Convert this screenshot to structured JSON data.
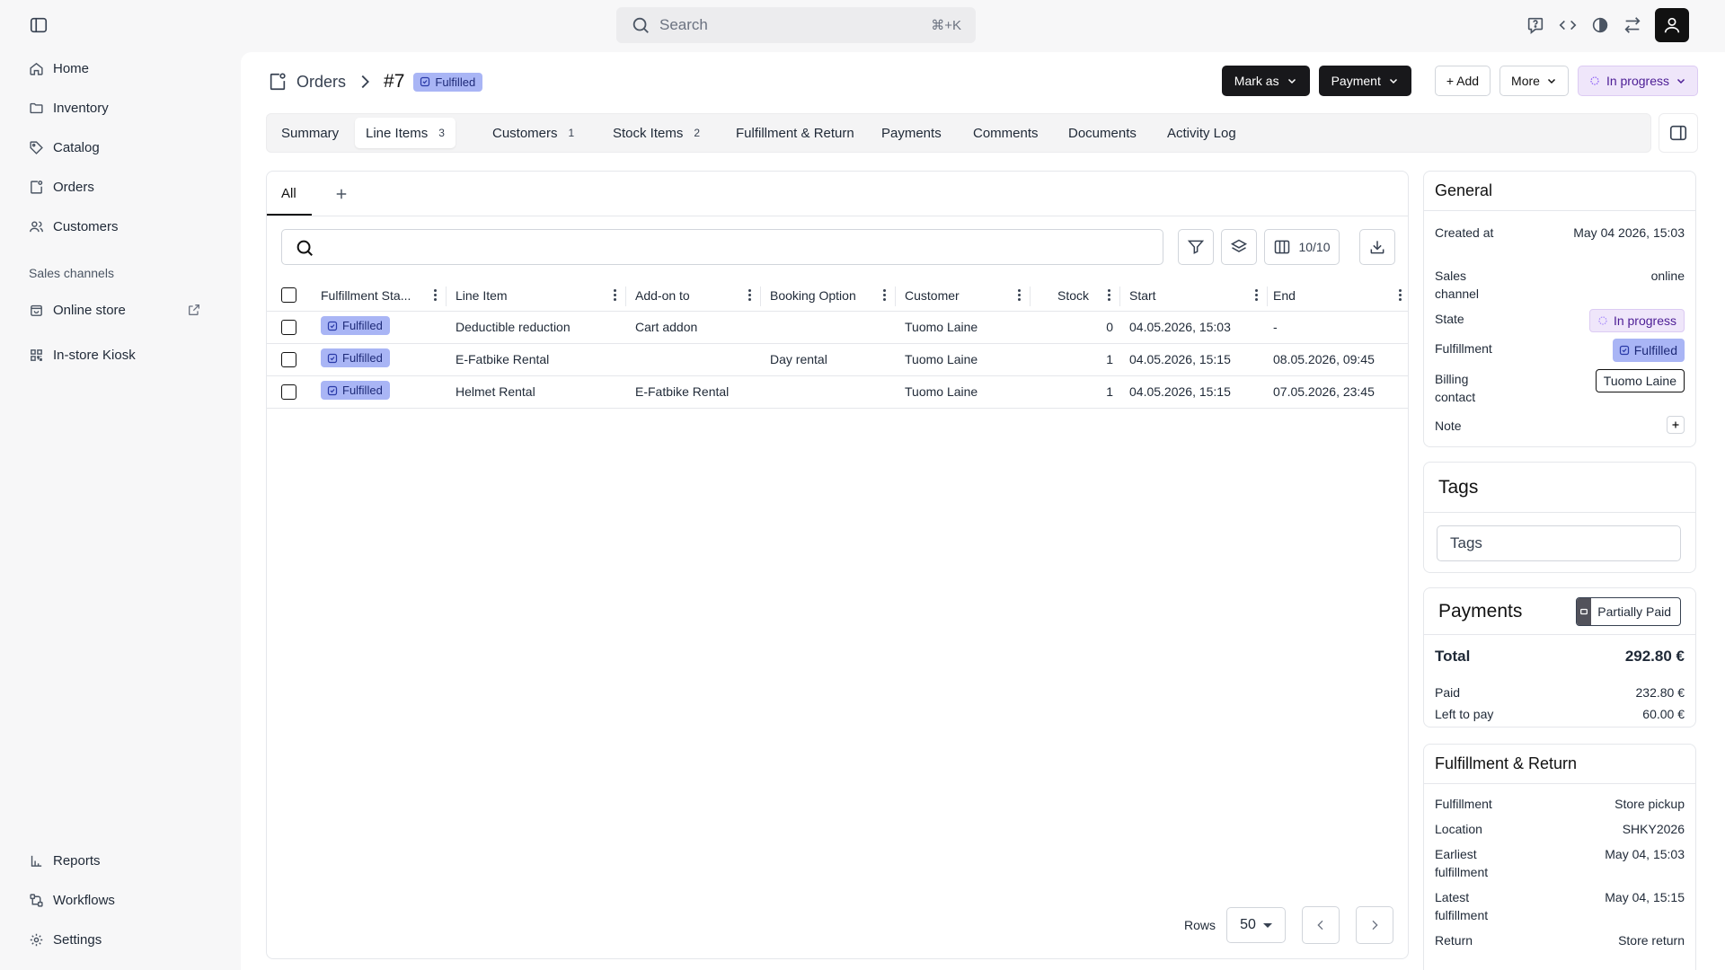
{
  "search": {
    "placeholder": "Search",
    "shortcut": "⌘+K"
  },
  "sidebar": {
    "items": [
      {
        "label": "Home",
        "icon": "home-icon"
      },
      {
        "label": "Inventory",
        "icon": "folder-icon"
      },
      {
        "label": "Catalog",
        "icon": "tag-icon"
      },
      {
        "label": "Orders",
        "icon": "orders-icon"
      },
      {
        "label": "Customers",
        "icon": "users-icon"
      }
    ],
    "section_title": "Sales channels",
    "channels": [
      {
        "label": "Online store"
      },
      {
        "label": "In-store Kiosk"
      }
    ],
    "bottom_items": [
      {
        "label": "Reports"
      },
      {
        "label": "Workflows"
      },
      {
        "label": "Settings"
      }
    ]
  },
  "header": {
    "breadcrumb": "Orders",
    "order_id": "#7",
    "status_badge": "Fulfilled",
    "actions": {
      "mark_as": "Mark as",
      "payment": "Payment",
      "add": "+ Add",
      "more": "More",
      "state": "In progress"
    }
  },
  "tabs": [
    {
      "label": "Summary",
      "count": ""
    },
    {
      "label": "Line Items",
      "count": "3"
    },
    {
      "label": "Customers",
      "count": "1"
    },
    {
      "label": "Stock Items",
      "count": "2"
    },
    {
      "label": "Fulfillment & Return",
      "count": ""
    },
    {
      "label": "Payments",
      "count": ""
    },
    {
      "label": "Comments",
      "count": ""
    },
    {
      "label": "Documents",
      "count": ""
    },
    {
      "label": "Activity Log",
      "count": ""
    }
  ],
  "table": {
    "view_tab": "All",
    "columns_count": "10/10",
    "columns": [
      "Fulfillment Sta...",
      "Line Item",
      "Add-on to",
      "Booking Option",
      "Customer",
      "Stock",
      "Start",
      "End"
    ],
    "rows": [
      {
        "status": "Fulfilled",
        "line_item": "Deductible reduction",
        "addon_to": "Cart addon",
        "booking_option": "",
        "customer": "Tuomo Laine",
        "stock": "0",
        "start": "04.05.2026, 15:03",
        "end": "-"
      },
      {
        "status": "Fulfilled",
        "line_item": "E-Fatbike Rental",
        "addon_to": "",
        "booking_option": "Day rental",
        "customer": "Tuomo Laine",
        "stock": "1",
        "start": "04.05.2026, 15:15",
        "end": "08.05.2026, 09:45"
      },
      {
        "status": "Fulfilled",
        "line_item": "Helmet Rental",
        "addon_to": "E-Fatbike Rental",
        "booking_option": "",
        "customer": "Tuomo Laine",
        "stock": "1",
        "start": "04.05.2026, 15:15",
        "end": "07.05.2026, 23:45"
      }
    ],
    "rows_label": "Rows",
    "rows_per_page": "50"
  },
  "general": {
    "title": "General",
    "created_label": "Created at",
    "created_value": "May 04 2026, 15:03",
    "channel_label": "Sales channel",
    "channel_value": "online",
    "state_label": "State",
    "state_value": "In progress",
    "fulfillment_label": "Fulfillment",
    "fulfillment_value": "Fulfilled",
    "billing_label": "Billing contact",
    "billing_value": "Tuomo Laine",
    "note_label": "Note"
  },
  "tags": {
    "title": "Tags",
    "placeholder": "Tags"
  },
  "payments": {
    "title": "Payments",
    "status": "Partially Paid",
    "total_label": "Total",
    "total_value": "292.80 €",
    "paid_label": "Paid",
    "paid_value": "232.80 €",
    "left_label": "Left to pay",
    "left_value": "60.00 €"
  },
  "fulfillment_return": {
    "title": "Fulfillment & Return",
    "fulfillment_label": "Fulfillment",
    "fulfillment_value": "Store pickup",
    "location_label": "Location",
    "location_value": "SHKY2026",
    "earliest_label": "Earliest fulfillment",
    "earliest_value": "May 04, 15:03",
    "latest_label": "Latest fulfillment",
    "latest_value": "May 04, 15:15",
    "return_label": "Return",
    "return_value": "Store return"
  }
}
